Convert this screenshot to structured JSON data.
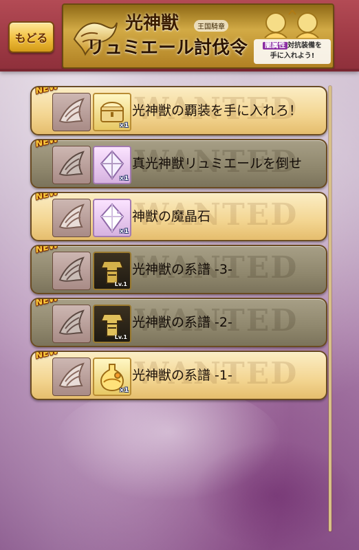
{
  "header": {
    "back_label": "もどる",
    "banner": {
      "title_line1": "光神獣",
      "chapter_tag": "王国騎章",
      "title_line2": "リュミエール討伐令",
      "promo_highlight": "闇属性",
      "promo_line1_rest": "対抗装備を",
      "promo_line2": "手に入れよう!"
    }
  },
  "watermark_text": "WANTED",
  "quests": [
    {
      "badge": "NEW",
      "title": "光神獣の覇装を手に入れろ！",
      "state": "active",
      "item_icon": "treasure-chest-icon",
      "qty": "×1"
    },
    {
      "badge": "NEW",
      "title": "真光神獣リュミエールを倒せ",
      "state": "dim",
      "item_icon": "crystal-icon",
      "qty": "×1"
    },
    {
      "badge": "NEW",
      "title": "神獣の魔晶石",
      "state": "active",
      "item_icon": "crystal-icon",
      "qty": "×1"
    },
    {
      "badge": "NEW",
      "title": "光神獣の系譜 -3-",
      "state": "dim",
      "item_icon": "armor-icon",
      "qty": "Lv.1"
    },
    {
      "badge": "NEW",
      "title": "光神獣の系譜 -2-",
      "state": "dim",
      "item_icon": "armor-icon",
      "qty": "Lv.1"
    },
    {
      "badge": "NEW",
      "title": "光神獣の系譜 -1-",
      "state": "active",
      "item_icon": "potion-icon",
      "qty": "×1"
    }
  ],
  "colors": {
    "topbar": "#9f3a45",
    "row_active": "#f3d591",
    "row_dim": "#8f876d",
    "badge": "#ffcc3b"
  }
}
